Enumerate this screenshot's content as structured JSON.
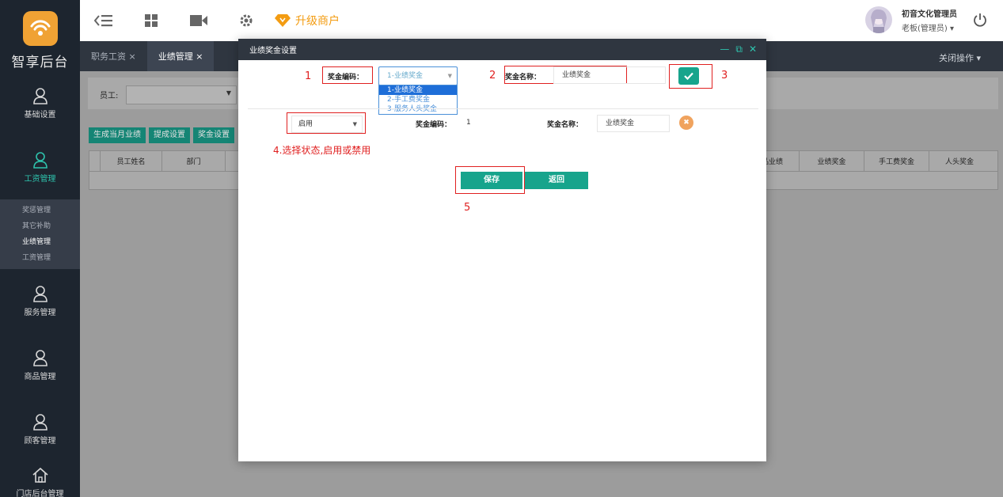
{
  "sidebar": {
    "logo_text": "智享后台",
    "items": [
      {
        "label": "基础设置"
      },
      {
        "label": "工资管理"
      },
      {
        "label": "服务管理"
      },
      {
        "label": "商品管理"
      },
      {
        "label": "顾客管理"
      },
      {
        "label": "门店后台管理"
      }
    ],
    "subitems": [
      "奖惩管理",
      "其它补助",
      "业绩管理",
      "工资管理"
    ]
  },
  "topbar": {
    "upgrade_label": "升级商户",
    "user_name": "初音文化管理员",
    "user_role": "老板(管理员) ▾"
  },
  "tabs": {
    "items": [
      {
        "label": "职务工资 ×"
      },
      {
        "label": "业绩管理 ×"
      }
    ],
    "close_ops": "关闭操作 ▾"
  },
  "background": {
    "filter_label": "员工:",
    "buttons": [
      "生成当月业绩",
      "提成设置",
      "奖金设置"
    ],
    "table_headers": [
      "员工姓名",
      "部门",
      "商品业绩",
      "业绩奖金",
      "手工费奖金",
      "人头奖金"
    ]
  },
  "modal": {
    "title": "业绩奖金设置",
    "row1": {
      "code_label": "奖金编码：",
      "code_selected": "1-业绩奖金",
      "code_options": [
        "1-业绩奖金",
        "2-手工费奖金",
        "3-服务人头奖金"
      ],
      "name_label": "奖金名称：",
      "name_value": "业绩奖金"
    },
    "row2": {
      "status_value": "启用",
      "code_label": "奖金编码：",
      "code_value": "1",
      "name_label": "奖金名称：",
      "name_value": "业绩奖金"
    },
    "annotations": {
      "n1": "1",
      "n2": "2",
      "n3": "3",
      "n4": "4.选择状态,启用或禁用",
      "n5": "5"
    },
    "save_label": "保存",
    "back_label": "返回"
  },
  "colors": {
    "accent": "#17a48c",
    "sidebar_bg": "#1d252f",
    "upgrade": "#f39c12",
    "annotation_red": "#e02020"
  }
}
